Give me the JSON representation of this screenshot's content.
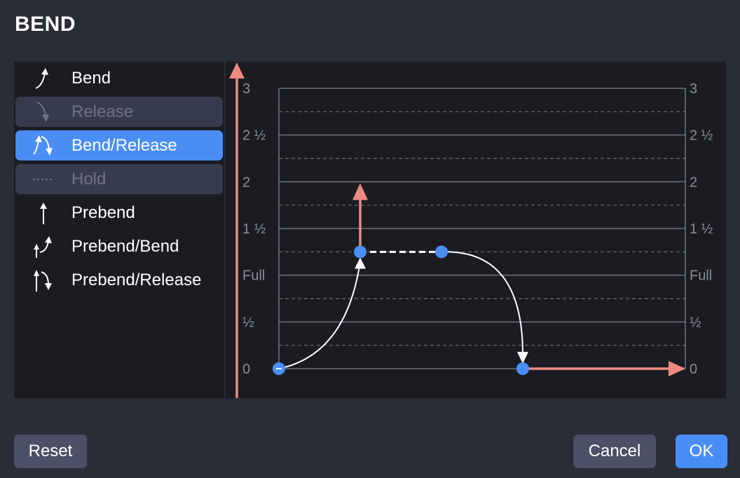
{
  "dialog": {
    "title": "BEND"
  },
  "bend_types": [
    {
      "label": "Bend",
      "icon": "bend-icon",
      "state": "normal"
    },
    {
      "label": "Release",
      "icon": "release-icon",
      "state": "disabled"
    },
    {
      "label": "Bend/Release",
      "icon": "bend-release-icon",
      "state": "selected"
    },
    {
      "label": "Hold",
      "icon": "hold-icon",
      "state": "disabled"
    },
    {
      "label": "Prebend",
      "icon": "prebend-icon",
      "state": "normal"
    },
    {
      "label": "Prebend/Bend",
      "icon": "prebend-bend-icon",
      "state": "normal"
    },
    {
      "label": "Prebend/Release",
      "icon": "prebend-release-icon",
      "state": "normal"
    }
  ],
  "graph": {
    "y_tick_labels": [
      "0",
      "½",
      "Full",
      "1 ½",
      "2",
      "2 ½",
      "3"
    ],
    "y_range": [
      0,
      3
    ],
    "grid": "solid at each half step, dashed at quarter steps",
    "x_steps": 5,
    "points": [
      {
        "step": 0,
        "pitch": 0
      },
      {
        "step": 1,
        "pitch": 1.25
      },
      {
        "step": 2,
        "pitch": 1.25
      },
      {
        "step": 3,
        "pitch": 0
      }
    ],
    "colors": {
      "background": "#1b1c22",
      "grid": "#6d7080",
      "point": "#4a8ef5",
      "curve": "#ffffff",
      "axis_arrow": "#ee8a80"
    }
  },
  "buttons": {
    "reset": "Reset",
    "cancel": "Cancel",
    "ok": "OK"
  }
}
